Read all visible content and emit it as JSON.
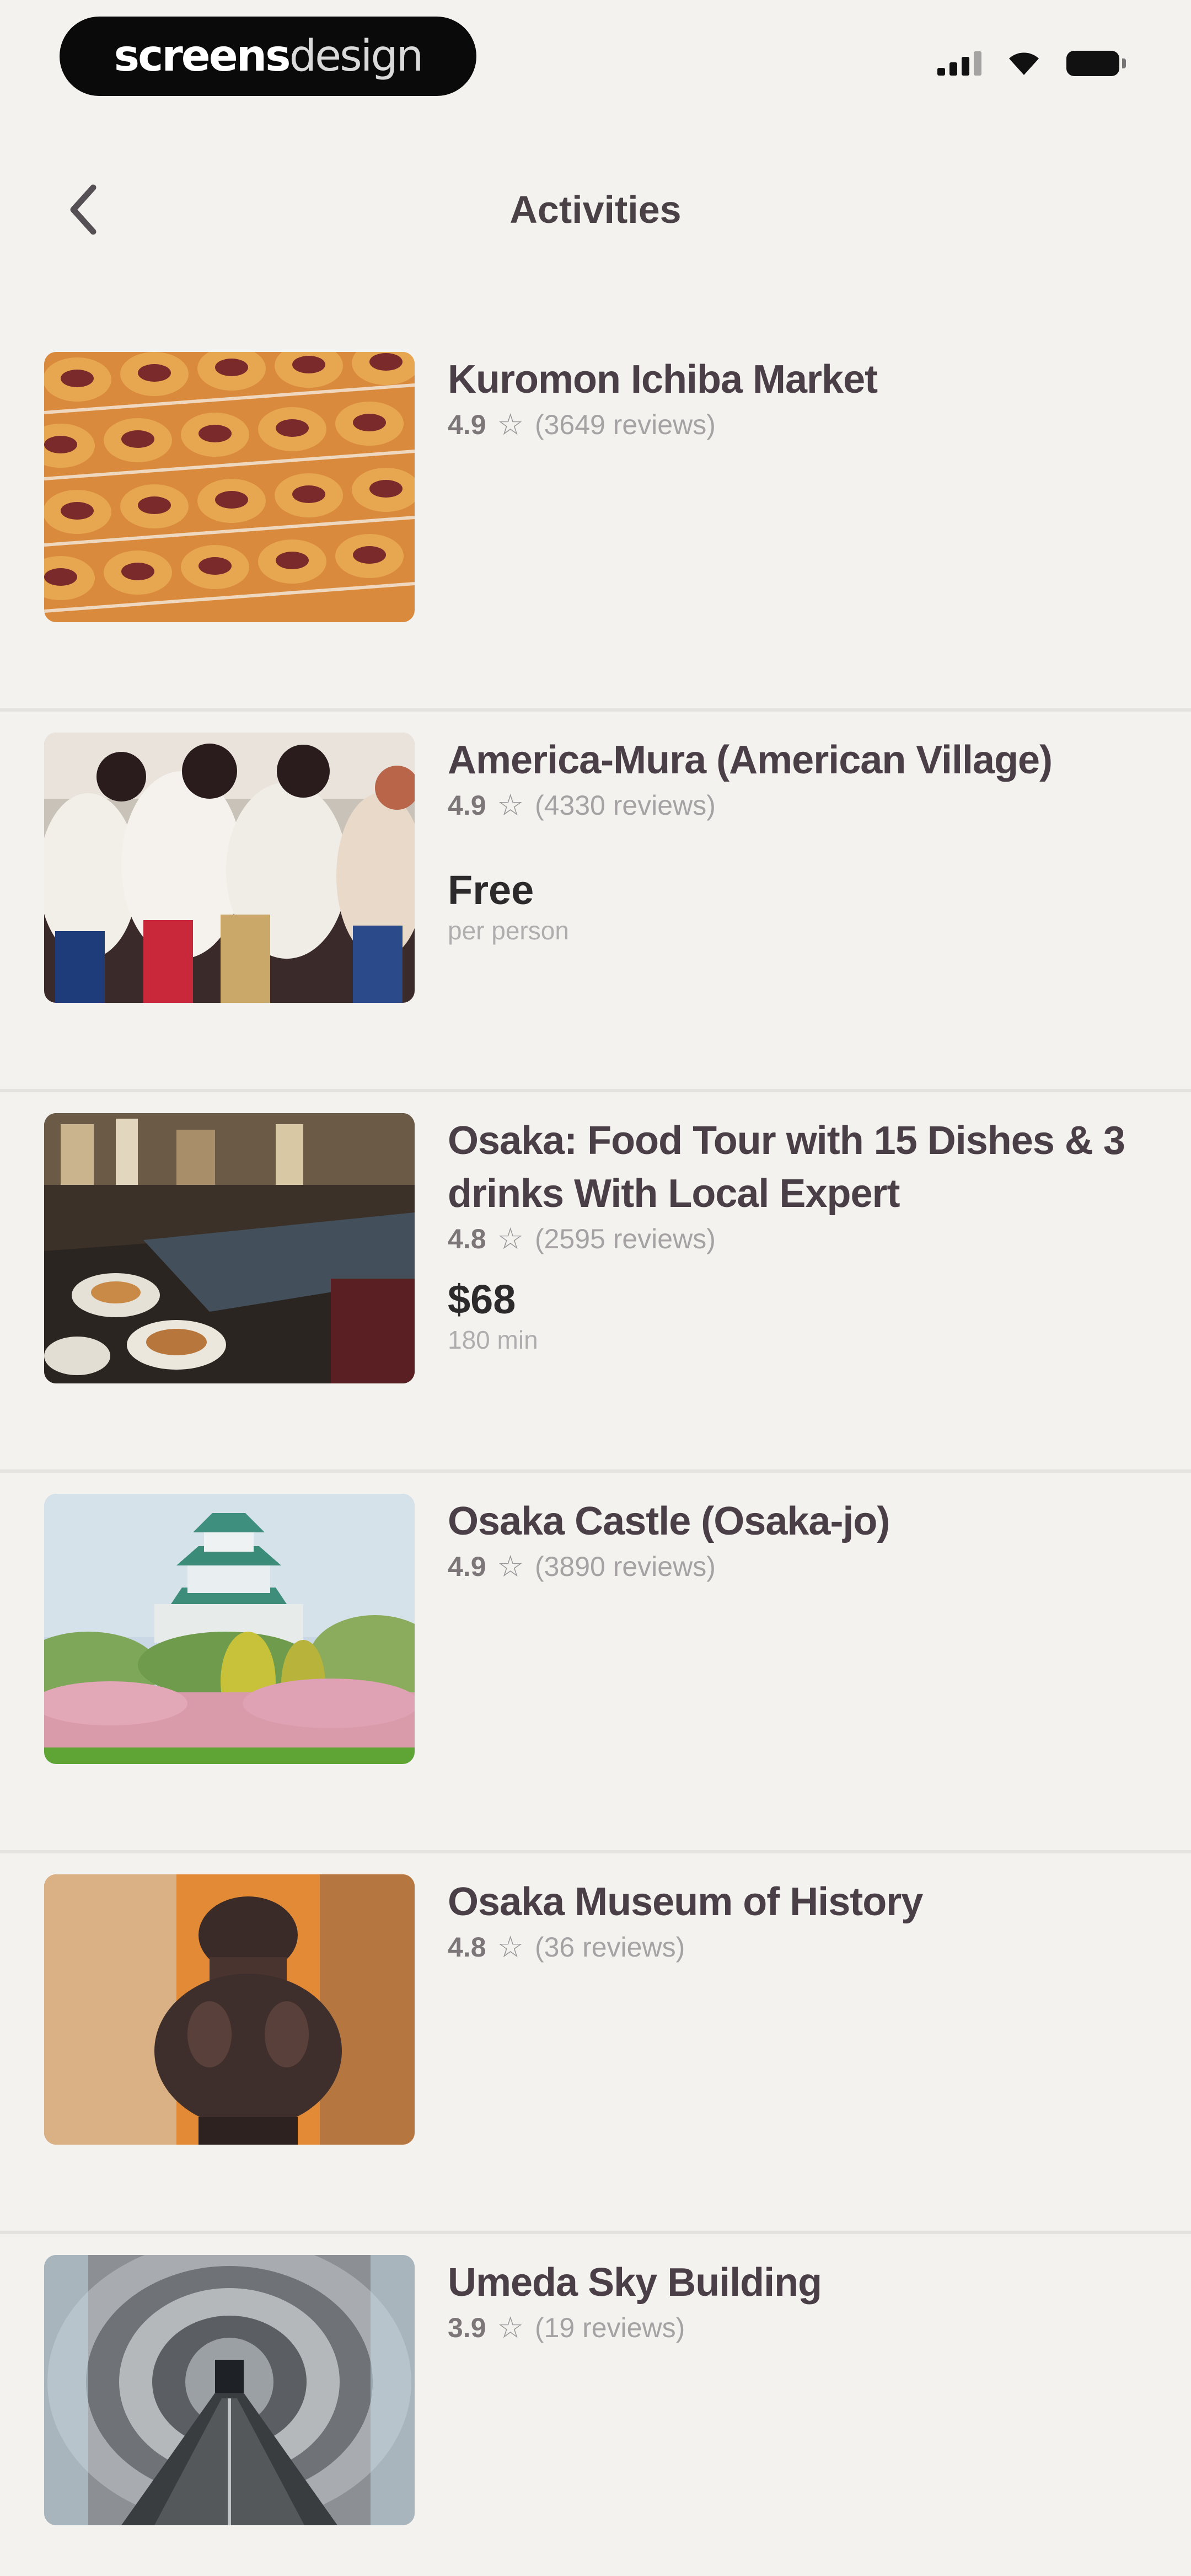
{
  "status_bar": {
    "brand_bold": "screens",
    "brand_light": "design"
  },
  "nav": {
    "title": "Activities",
    "back_icon": "chevron-left-icon"
  },
  "activities": [
    {
      "title": "Kuromon Ichiba Market",
      "rating": "4.9",
      "reviews": "(3649 reviews)",
      "price": "",
      "price_sub": ""
    },
    {
      "title": "America-Mura (American Village)",
      "rating": "4.9",
      "reviews": "(4330 reviews)",
      "price": "Free",
      "price_sub": "per person"
    },
    {
      "title": "Osaka: Food Tour with 15 Dishes & 3 drinks With Local Expert",
      "rating": "4.8",
      "reviews": "(2595 reviews)",
      "price": "$68",
      "price_sub": "180 min"
    },
    {
      "title": "Osaka Castle (Osaka-jo)",
      "rating": "4.9",
      "reviews": "(3890 reviews)",
      "price": "",
      "price_sub": ""
    },
    {
      "title": "Osaka Museum of History",
      "rating": "4.8",
      "reviews": "(36 reviews)",
      "price": "",
      "price_sub": ""
    },
    {
      "title": "Umeda Sky Building",
      "rating": "3.9",
      "reviews": "(19 reviews)",
      "price": "",
      "price_sub": ""
    }
  ],
  "colors": {
    "background": "#f3f2ef",
    "title_text": "#4a3f47",
    "meta_text": "#a6a2a4",
    "divider": "#e4e3df"
  }
}
